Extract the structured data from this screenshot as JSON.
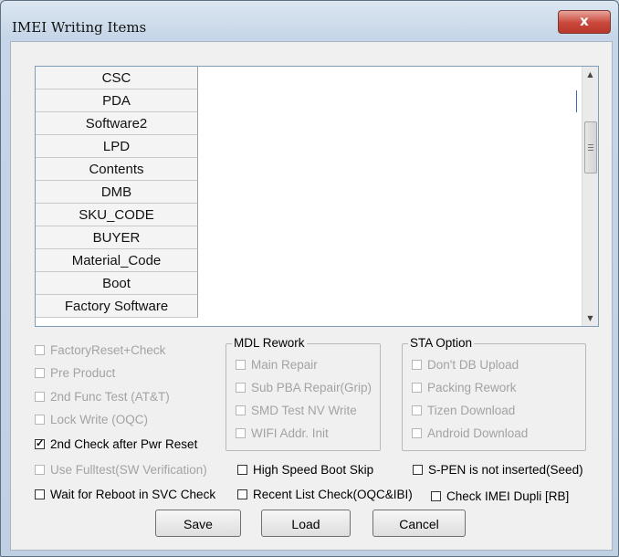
{
  "window": {
    "title": "IMEI Writing Items",
    "close_label": "x"
  },
  "items": [
    "CSC",
    "PDA",
    "Software2",
    "LPD",
    "Contents",
    "DMB",
    "SKU_CODE",
    "BUYER",
    "Material_Code",
    "Boot",
    "Factory Software"
  ],
  "left_options": [
    {
      "label": "FactoryReset+Check",
      "checked": false,
      "enabled": false
    },
    {
      "label": "Pre Product",
      "checked": false,
      "enabled": false
    },
    {
      "label": "2nd Func Test (AT&T)",
      "checked": false,
      "enabled": false
    },
    {
      "label": "Lock Write (OQC)",
      "checked": false,
      "enabled": false
    },
    {
      "label": "2nd Check after Pwr Reset",
      "checked": true,
      "enabled": true
    },
    {
      "label": "Use Fulltest(SW Verification)",
      "checked": false,
      "enabled": false
    },
    {
      "label": "Wait for Reboot in SVC Check",
      "checked": false,
      "enabled": true
    }
  ],
  "mdl_rework": {
    "title": "MDL Rework",
    "options": [
      {
        "label": "Main Repair",
        "checked": false,
        "enabled": false
      },
      {
        "label": "Sub PBA Repair(Grip)",
        "checked": false,
        "enabled": false
      },
      {
        "label": "SMD Test NV Write",
        "checked": false,
        "enabled": false
      },
      {
        "label": "WIFI Addr. Init",
        "checked": false,
        "enabled": false
      }
    ]
  },
  "sta_option": {
    "title": "STA Option",
    "options": [
      {
        "label": "Don't DB Upload",
        "checked": false,
        "enabled": false
      },
      {
        "label": "Packing Rework",
        "checked": false,
        "enabled": false
      },
      {
        "label": "Tizen Download",
        "checked": false,
        "enabled": false
      },
      {
        "label": "Android Download",
        "checked": false,
        "enabled": false
      }
    ]
  },
  "mid_options": [
    {
      "label": "High Speed Boot Skip",
      "checked": false,
      "enabled": true
    },
    {
      "label": "Recent List Check(OQC&IBI)",
      "checked": false,
      "enabled": true
    }
  ],
  "right_options": [
    {
      "label": "S-PEN is not inserted(Seed)",
      "checked": false,
      "enabled": true
    },
    {
      "label": "Check IMEI Dupli [RB]",
      "checked": false,
      "enabled": true
    }
  ],
  "buttons": {
    "save": "Save",
    "load": "Load",
    "cancel": "Cancel"
  }
}
